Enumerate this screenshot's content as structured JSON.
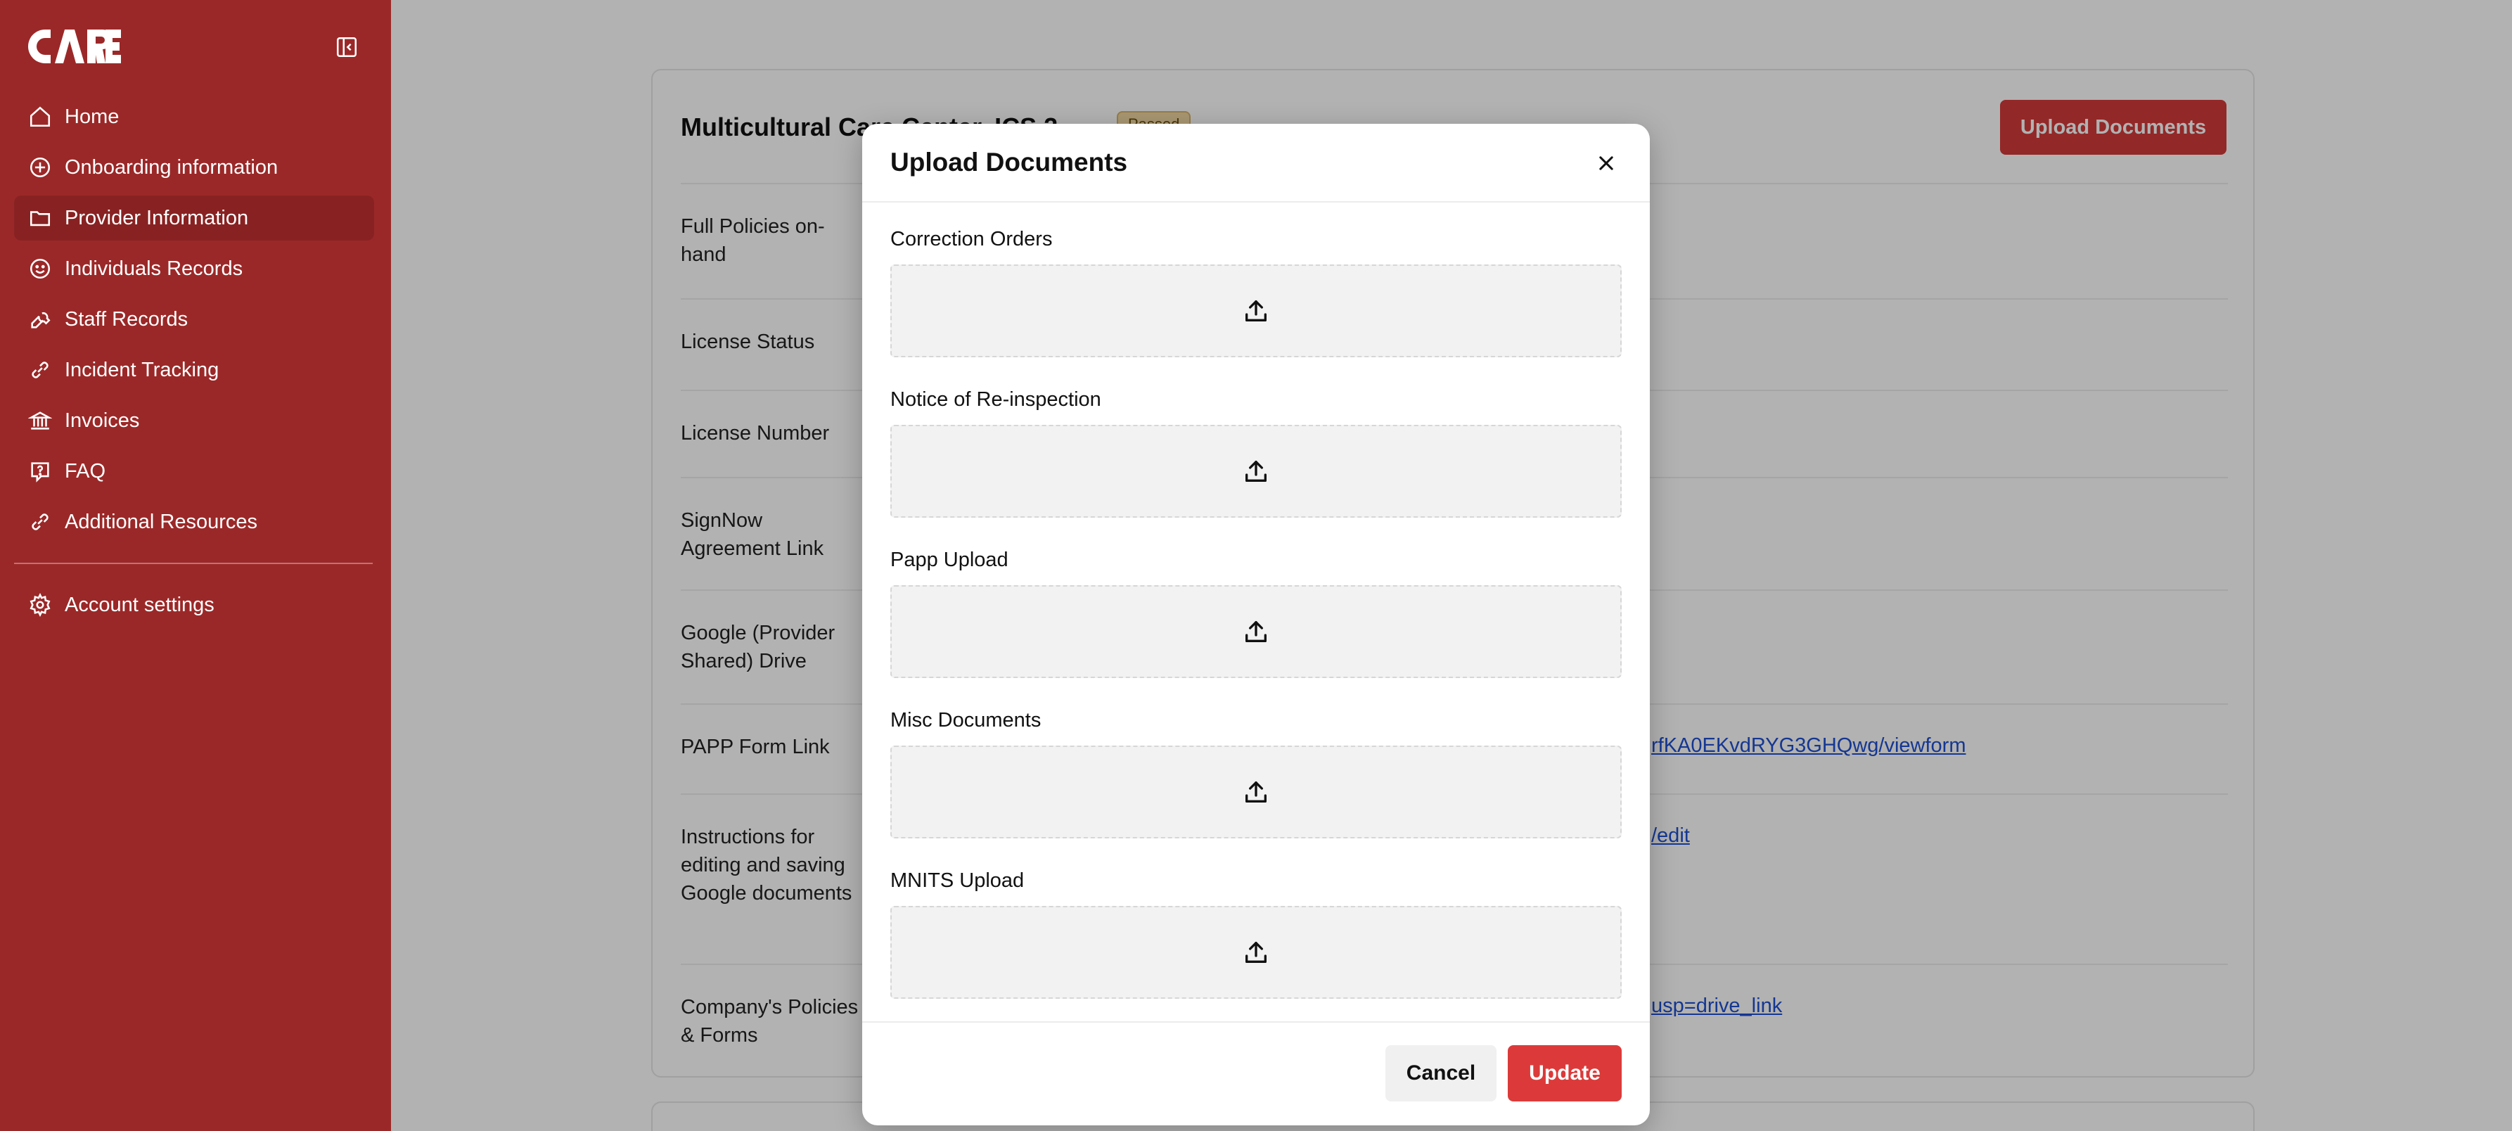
{
  "sidebar": {
    "logo_text": "CARE",
    "items": [
      {
        "label": "Home",
        "icon": "home-icon"
      },
      {
        "label": "Onboarding information",
        "icon": "plus-circle-icon"
      },
      {
        "label": "Provider Information",
        "icon": "folder-icon"
      },
      {
        "label": "Individuals Records",
        "icon": "smile-icon"
      },
      {
        "label": "Staff Records",
        "icon": "wrench-icon"
      },
      {
        "label": "Incident Tracking",
        "icon": "link-icon"
      },
      {
        "label": "Invoices",
        "icon": "bank-icon"
      },
      {
        "label": "FAQ",
        "icon": "help-icon"
      },
      {
        "label": "Additional Resources",
        "icon": "link-icon"
      }
    ],
    "active_index": 2,
    "bottom_items": [
      {
        "label": "Account settings",
        "icon": "gear-icon"
      }
    ]
  },
  "main": {
    "card_title": "Multicultural Care Center, ICS 2",
    "status_pill": "Passed",
    "upload_button": "Upload Documents",
    "rows": [
      {
        "label": "Full Policies on-hand",
        "value": ""
      },
      {
        "label": "License Status",
        "value": ""
      },
      {
        "label": "License Number",
        "value": ""
      },
      {
        "label": "SignNow Agreement Link",
        "value": ""
      },
      {
        "label": "Google (Provider Shared) Drive",
        "value": ""
      },
      {
        "label": "PAPP Form Link",
        "value": "rfKA0EKvdRYG3GHQwg/viewform"
      },
      {
        "label": "Instructions for editing and saving Google documents",
        "value": "/edit"
      },
      {
        "label": "Company's Policies & Forms",
        "value": "usp=drive_link"
      }
    ]
  },
  "modal": {
    "title": "Upload Documents",
    "fields": [
      {
        "label": "Correction Orders"
      },
      {
        "label": "Notice of Re-inspection"
      },
      {
        "label": "Papp Upload"
      },
      {
        "label": "Misc Documents"
      },
      {
        "label": "MNITS Upload"
      }
    ],
    "cancel_label": "Cancel",
    "update_label": "Update"
  },
  "colors": {
    "sidebar_bg": "#9b2828",
    "accent": "#dc3a3a",
    "link": "#1f4fd1"
  }
}
